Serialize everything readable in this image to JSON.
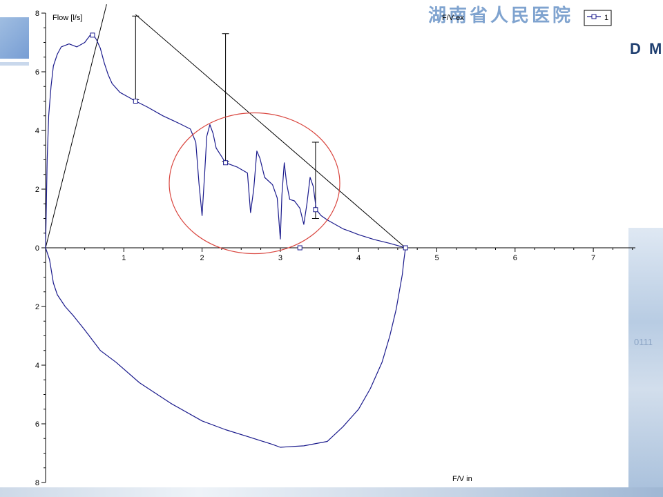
{
  "watermark": {
    "title": "湖南省人民医院",
    "brand": "D M",
    "digits": "0111"
  },
  "chart_data": {
    "type": "line",
    "title": "",
    "ylabel": "Flow [l/s]",
    "xlabel_top": "F/V ex",
    "xlabel_bottom": "F/V in",
    "xlim": [
      0,
      7.6
    ],
    "ylim": [
      -8,
      8
    ],
    "x_ticks": [
      1,
      2,
      3,
      4,
      5,
      6,
      7
    ],
    "y_ticks_top": [
      0,
      2,
      4,
      6,
      8
    ],
    "y_ticks_bottom": [
      2,
      4,
      6,
      8
    ],
    "legend": {
      "entries": [
        "1"
      ],
      "placement": "top-right"
    },
    "expiratory": {
      "x": [
        0,
        0.02,
        0.04,
        0.07,
        0.1,
        0.15,
        0.2,
        0.3,
        0.4,
        0.5,
        0.57,
        0.6,
        0.65,
        0.7,
        0.75,
        0.8,
        0.85,
        0.95,
        1.05,
        1.15,
        1.3,
        1.5,
        1.7,
        1.85,
        1.92,
        1.96,
        2.0,
        2.03,
        2.06,
        2.1,
        2.14,
        2.18,
        2.24,
        2.3,
        2.45,
        2.58,
        2.62,
        2.66,
        2.7,
        2.74,
        2.8,
        2.9,
        2.96,
        3.0,
        3.02,
        3.05,
        3.08,
        3.12,
        3.18,
        3.25,
        3.3,
        3.34,
        3.38,
        3.42,
        3.46,
        3.52,
        3.6,
        3.7,
        3.8,
        3.9,
        4.0,
        4.2,
        4.4,
        4.6
      ],
      "y": [
        0,
        3.0,
        4.5,
        5.5,
        6.2,
        6.6,
        6.85,
        6.95,
        6.85,
        7.0,
        7.25,
        7.3,
        7.1,
        6.8,
        6.3,
        5.9,
        5.6,
        5.3,
        5.15,
        5.0,
        4.8,
        4.5,
        4.25,
        4.05,
        3.6,
        2.2,
        1.1,
        2.4,
        3.8,
        4.2,
        3.9,
        3.4,
        3.15,
        2.9,
        2.75,
        2.55,
        1.2,
        2.0,
        3.3,
        3.05,
        2.4,
        2.15,
        1.7,
        0.3,
        1.8,
        2.9,
        2.2,
        1.65,
        1.6,
        1.35,
        0.8,
        1.5,
        2.4,
        2.1,
        1.3,
        1.1,
        0.95,
        0.8,
        0.65,
        0.55,
        0.45,
        0.28,
        0.15,
        0
      ]
    },
    "inspiratory": {
      "x": [
        0,
        0.05,
        0.1,
        0.15,
        0.25,
        0.35,
        0.5,
        0.7,
        0.9,
        1.2,
        1.6,
        2.0,
        2.3,
        2.6,
        2.9,
        3.0,
        3.1,
        3.3,
        3.6,
        3.8,
        4.0,
        4.15,
        4.3,
        4.4,
        4.48,
        4.52,
        4.56,
        4.58,
        4.6
      ],
      "y": [
        0,
        -0.4,
        -1.2,
        -1.6,
        -2.0,
        -2.3,
        -2.8,
        -3.5,
        -3.9,
        -4.6,
        -5.3,
        -5.9,
        -6.2,
        -6.45,
        -6.7,
        -6.8,
        -6.78,
        -6.75,
        -6.6,
        -6.1,
        -5.5,
        -4.8,
        -3.9,
        -3.0,
        -2.1,
        -1.5,
        -0.9,
        -0.4,
        0
      ]
    },
    "markers": [
      {
        "x": 0.6,
        "y": 7.25
      },
      {
        "x": 1.15,
        "y": 5.0
      },
      {
        "x": 2.3,
        "y": 2.9
      },
      {
        "x": 3.45,
        "y": 1.3
      },
      {
        "x": 3.25,
        "y": 0
      },
      {
        "x": 4.6,
        "y": 0
      }
    ],
    "error_bars": [
      {
        "x": 1.15,
        "low": 5.05,
        "high": 7.9
      },
      {
        "x": 2.3,
        "low": 2.95,
        "high": 7.3
      },
      {
        "x": 3.45,
        "low": 1.0,
        "high": 3.6
      }
    ],
    "reference_lines": [
      {
        "x1": 0,
        "y1": 0,
        "x2": 0.78,
        "y2": 8.3
      },
      {
        "x1": 1.15,
        "y1": 7.95,
        "x2": 4.6,
        "y2": 0
      }
    ],
    "annotation_ellipse": {
      "cx": 2.67,
      "cy": 2.2,
      "rx": 1.09,
      "ry": 2.4,
      "color": "#d9453e"
    },
    "colors": {
      "curve": "#1a1a8c",
      "reference": "#000000",
      "ellipse": "#d9453e"
    }
  }
}
